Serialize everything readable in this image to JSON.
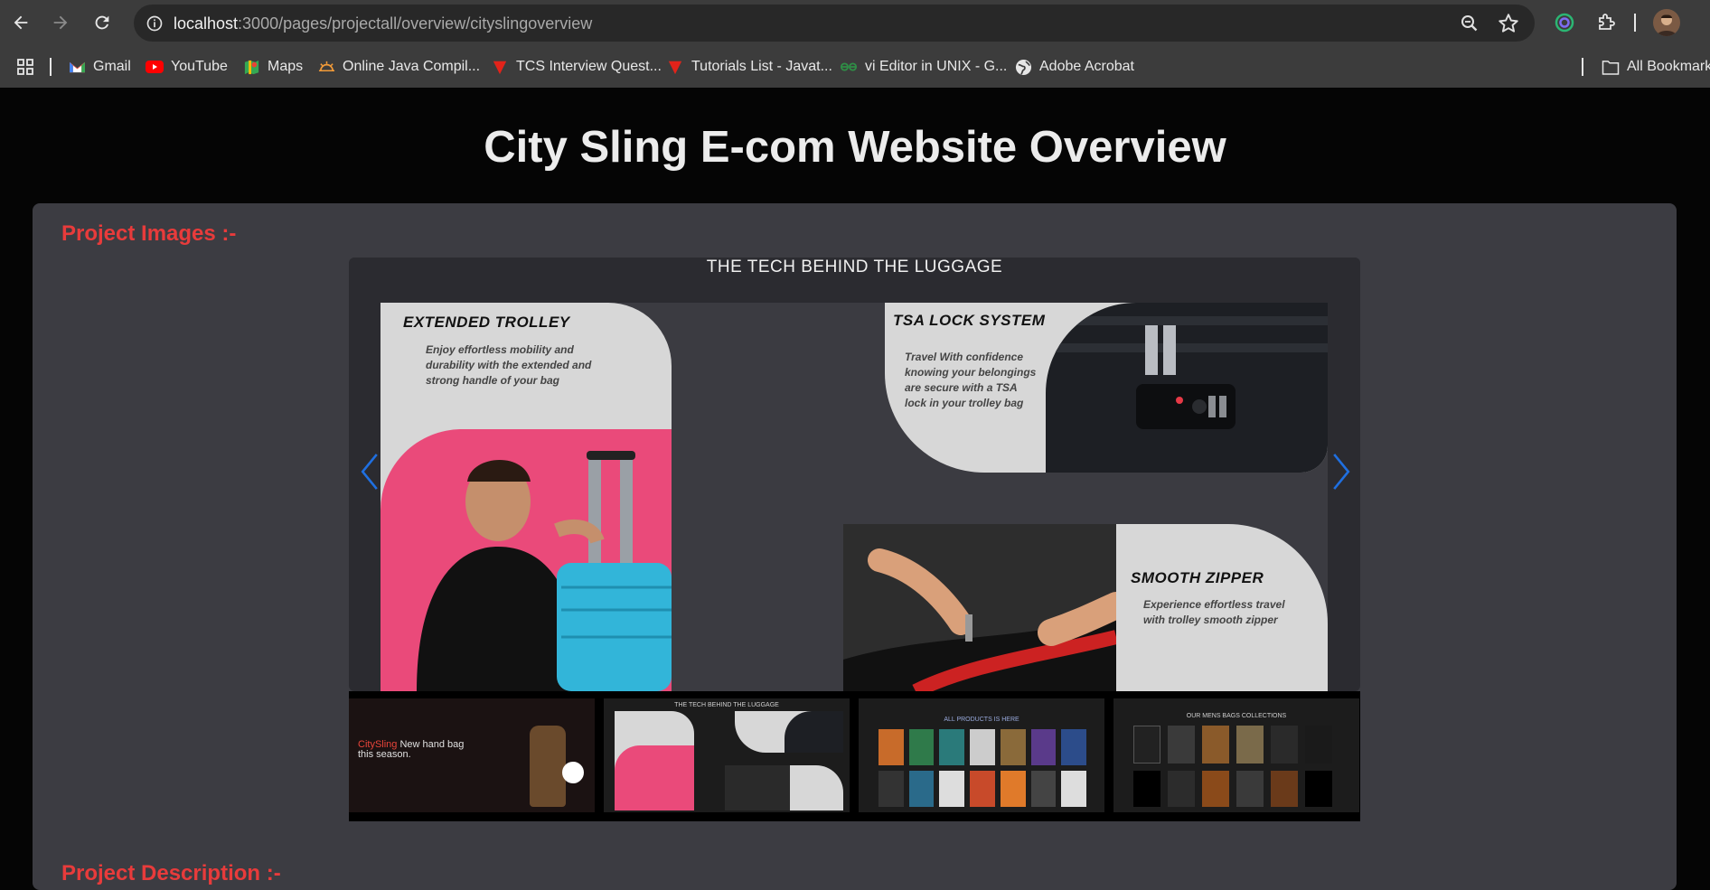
{
  "browser": {
    "url_host": "localhost",
    "url_path": ":3000/pages/projectall/overview/cityslingoverview",
    "bookmarks": [
      {
        "label": "Gmail",
        "icon": "gmail-icon"
      },
      {
        "label": "YouTube",
        "icon": "youtube-icon"
      },
      {
        "label": "Maps",
        "icon": "maps-icon"
      },
      {
        "label": "Online Java Compil...",
        "icon": "sun-icon"
      },
      {
        "label": "TCS Interview Quest...",
        "icon": "red-triangle-icon"
      },
      {
        "label": "Tutorials List - Javat...",
        "icon": "red-triangle-icon"
      },
      {
        "label": "vi Editor in UNIX - G...",
        "icon": "gfg-icon"
      },
      {
        "label": "Adobe Acrobat",
        "icon": "globe-icon"
      }
    ],
    "all_bookmarks": "All Bookmark"
  },
  "page": {
    "title": "City Sling E-com Website Overview",
    "images_label": "Project Images :-",
    "description_label": "Project Description :-"
  },
  "carousel": {
    "heading": "THE TECH BEHIND THE LUGGAGE",
    "cards": [
      {
        "title": "EXTENDED TROLLEY",
        "text": "Enjoy effortless mobility and durability with the extended and strong handle of your bag"
      },
      {
        "title": "TSA LOCK SYSTEM",
        "text": "Travel With confidence knowing your belongings are secure with a TSA lock in your trolley bag"
      },
      {
        "title": "SMOOTH ZIPPER",
        "text": "Experience effortless travel with trolley smooth zipper"
      }
    ]
  },
  "thumbnails": [
    {
      "caption": "",
      "hero_brand": "CitySling",
      "hero_text": "New hand bag this season."
    },
    {
      "caption": "THE TECH BEHIND THE LUGGAGE"
    },
    {
      "caption": "ALL PRODUCTS IS HERE"
    },
    {
      "caption": "OUR MENS BAGS COLLECTIONS"
    }
  ],
  "colors": {
    "accent_red": "#e83b3b",
    "arrow_blue": "#1f6fe0",
    "panel": "#3c3c42",
    "page_bg": "#050505"
  }
}
